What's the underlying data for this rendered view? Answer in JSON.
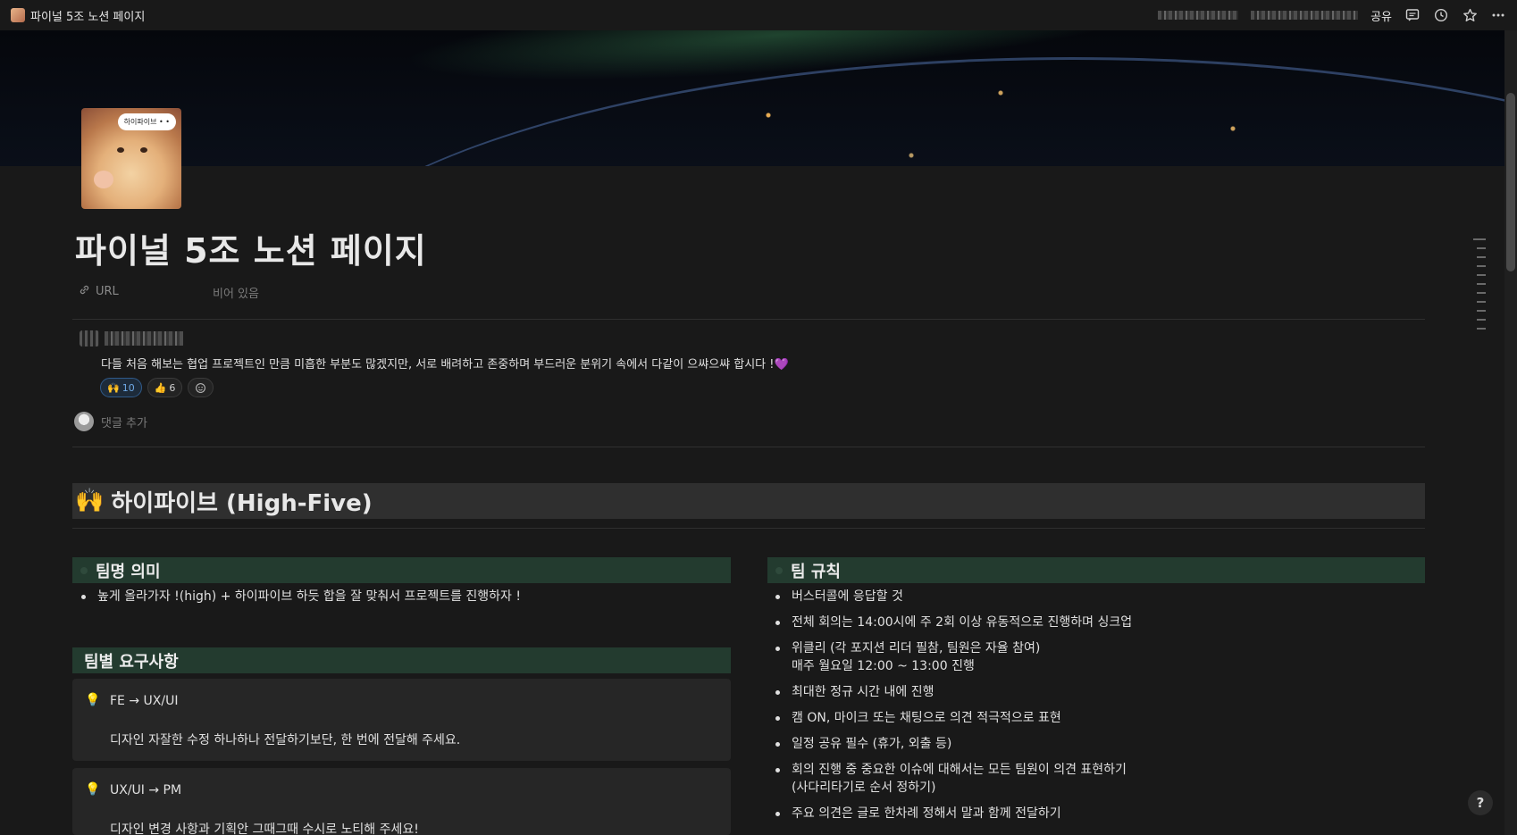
{
  "window": {
    "title": "파이널 5조 노션 페이지"
  },
  "topbar": {
    "share_label": "공유"
  },
  "page": {
    "icon_bubble_text": "하이파이브 • •",
    "title": "파이널 5조 노션 페이지",
    "property": {
      "name": "URL",
      "value_placeholder": "비어 있음"
    }
  },
  "comment": {
    "text": "다들 처음 해보는 협업 프로젝트인 만큼 미흡한 부분도 많겠지만, 서로 배려하고 존중하며 부드러운 분위기 속에서 다같이 으쌰으쌰 합시다 !💜",
    "reactions": [
      {
        "emoji": "🙌",
        "count": "10"
      },
      {
        "emoji": "👍",
        "count": "6"
      }
    ],
    "add_placeholder": "댓글 추가"
  },
  "heading": {
    "emoji": "🙌",
    "text": "하이파이브 (High-Five)"
  },
  "team_meaning": {
    "title": "팀명 의미",
    "items": [
      "높게 올라가자 !(high) + 하이파이브 하듯 합을 잘 맞춰서 프로젝트를 진행하자 !"
    ]
  },
  "team_requests": {
    "title": "팀별 요구사항",
    "callouts": [
      {
        "title": "FE → UX/UI",
        "body": "디자인 자잘한 수정 하나하나 전달하기보단, 한 번에 전달해 주세요."
      },
      {
        "title": "UX/UI → PM",
        "body": "디자인 변경 사항과 기획안 그때그때 수시로 노티해 주세요!"
      }
    ]
  },
  "team_rules": {
    "title": "팀 규칙",
    "items": [
      {
        "l1": "버스터콜에 응답할 것",
        "l2": ""
      },
      {
        "l1": "전체 회의는 14:00시에 주 2회 이상 유동적으로 진행하며 싱크업",
        "l2": ""
      },
      {
        "l1": "위클리 (각 포지션 리더 필참, 팀원은 자율 참여)",
        "l2": "매주 월요일 12:00 ~ 13:00 진행"
      },
      {
        "l1": "최대한 정규 시간 내에 진행",
        "l2": ""
      },
      {
        "l1": "캠 ON, 마이크 또는 채팅으로 의견 적극적으로 표현",
        "l2": ""
      },
      {
        "l1": "일정 공유 필수 (휴가, 외출 등)",
        "l2": ""
      },
      {
        "l1": "회의 진행 중 중요한 이슈에 대해서는 모든 팀원이 의견 표현하기",
        "l2": "(사다리타기로 순서 정하기)"
      },
      {
        "l1": "주요 의견은 글로 한차례 정해서 말과 함께 전달하기",
        "l2": ""
      }
    ]
  },
  "help_label": "?"
}
